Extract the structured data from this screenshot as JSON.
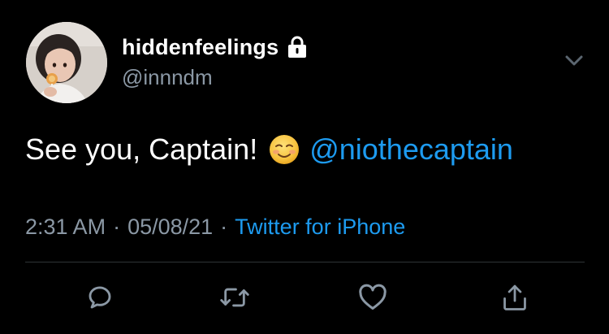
{
  "user": {
    "display_name": "hiddenfeelings",
    "handle": "@innndm",
    "protected_icon": "lock-icon",
    "avatar": "profile-photo"
  },
  "tweet": {
    "text_before": "See you, Captain!",
    "emoji": "☺️",
    "mention": "@niothecaptain"
  },
  "meta": {
    "time": "2:31 AM",
    "date": "05/08/21",
    "separator": "·",
    "source": "Twitter for iPhone"
  },
  "actions": [
    {
      "name": "reply",
      "icon": "reply-icon"
    },
    {
      "name": "retweet",
      "icon": "retweet-icon"
    },
    {
      "name": "like",
      "icon": "heart-icon"
    },
    {
      "name": "share",
      "icon": "share-icon"
    }
  ],
  "colors": {
    "background": "#000000",
    "text": "#ffffff",
    "muted": "#8b98a5",
    "link": "#1d9bf0",
    "divider": "#2f3336"
  }
}
